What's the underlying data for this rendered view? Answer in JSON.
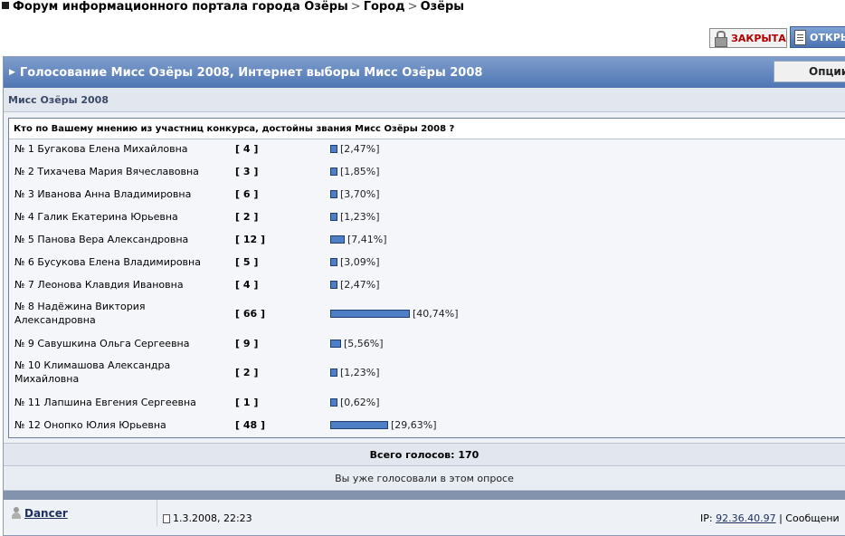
{
  "breadcrumb": {
    "items": [
      "Форум информационного портала города Озёры",
      "Город",
      "Озёры"
    ],
    "separator": ">"
  },
  "toolbar": {
    "closed_label": "ЗАКРЫТА",
    "open_label": "ОТКРЫ"
  },
  "topic": {
    "title": "Голосование Мисс Озёры 2008, Интернет выборы Мисс Озёры 2008",
    "options_label": "Опции",
    "subtitle": "Мисс Озёры 2008"
  },
  "poll": {
    "question": "Кто по Вашему мнению из участниц конкурса, достойны звания Мисс Озёры 2008 ?",
    "options": [
      {
        "name": "№ 1 Бугакова Елена Михайловна",
        "votes": "[ 4 ]",
        "percent": "[2,47%]",
        "value": 2.47
      },
      {
        "name": "№ 2 Тихачева Мария Вячеславовна",
        "votes": "[ 3 ]",
        "percent": "[1,85%]",
        "value": 1.85
      },
      {
        "name": "№ 3 Иванова Анна Владимировна",
        "votes": "[ 6 ]",
        "percent": "[3,70%]",
        "value": 3.7
      },
      {
        "name": "№ 4 Галик Екатерина Юрьевна",
        "votes": "[ 2 ]",
        "percent": "[1,23%]",
        "value": 1.23
      },
      {
        "name": "№ 5 Панова Вера Александровна",
        "votes": "[ 12 ]",
        "percent": "[7,41%]",
        "value": 7.41
      },
      {
        "name": "№ 6 Бусукова Елена Владимировна",
        "votes": "[ 5 ]",
        "percent": "[3,09%]",
        "value": 3.09
      },
      {
        "name": "№ 7 Леонова Клавдия Ивановна",
        "votes": "[ 4 ]",
        "percent": "[2,47%]",
        "value": 2.47
      },
      {
        "name": "№ 8 Надёжина Виктория Александровна",
        "votes": "[ 66 ]",
        "percent": "[40,74%]",
        "value": 40.74
      },
      {
        "name": "№ 9 Савушкина Ольга Сергеевна",
        "votes": "[ 9 ]",
        "percent": "[5,56%]",
        "value": 5.56
      },
      {
        "name": "№ 10 Климашова Александра Михайловна",
        "votes": "[ 2 ]",
        "percent": "[1,23%]",
        "value": 1.23
      },
      {
        "name": "№ 11 Лапшина Евгения Сергеевна",
        "votes": "[ 1 ]",
        "percent": "[0,62%]",
        "value": 0.62
      },
      {
        "name": "№ 12 Онопко Юлия Юрьевна",
        "votes": "[ 48 ]",
        "percent": "[29,63%]",
        "value": 29.63
      }
    ],
    "total_label": "Всего голосов: 170",
    "already_voted": "Вы уже голосовали в этом опросе"
  },
  "post": {
    "author": "Dancer",
    "date": "1.3.2008, 22:23",
    "ip_label": "IP:",
    "ip": "92.36.40.97",
    "divider": "|",
    "messages_label": "Сообщени"
  },
  "colors": {
    "title_bar": "#4f76b4",
    "bar_fill": "#4d7ec6",
    "closed_text": "#b00000"
  }
}
